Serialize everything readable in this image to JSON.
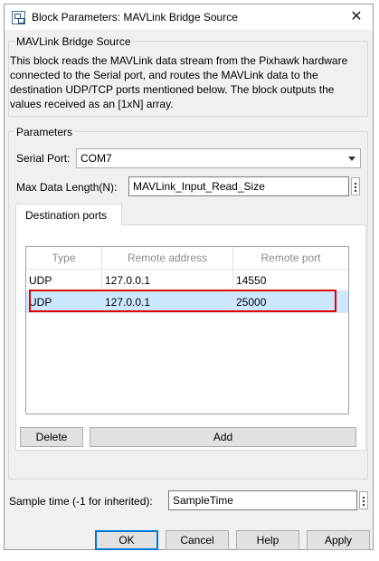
{
  "window": {
    "title": "Block Parameters: MAVLink Bridge Source",
    "close_glyph": "✕"
  },
  "block_group": {
    "legend": "MAVLink Bridge Source",
    "description": "This block reads the MAVLink data stream from the Pixhawk hardware connected to the Serial port, and routes the MAVLink data to the destination UDP/TCP ports mentioned below. The block outputs the values received as an [1xN] array."
  },
  "parameters": {
    "legend": "Parameters",
    "serial_port": {
      "label": "Serial Port:",
      "value": "COM7"
    },
    "max_data_length": {
      "label": "Max Data Length(N):",
      "value": "MAVLink_Input_Read_Size"
    }
  },
  "destination_ports": {
    "tab_label": "Destination ports",
    "columns": [
      "Type",
      "Remote address",
      "Remote port"
    ],
    "rows": [
      {
        "type": "UDP",
        "address": "127.0.0.1",
        "port": "14550"
      },
      {
        "type": "UDP",
        "address": "127.0.0.1",
        "port": "25000"
      }
    ],
    "delete_label": "Delete",
    "add_label": "Add"
  },
  "sample_time": {
    "label": "Sample time (-1 for inherited):",
    "value": "SampleTime"
  },
  "footer": {
    "ok": "OK",
    "cancel": "Cancel",
    "help": "Help",
    "apply": "Apply"
  },
  "colors": {
    "selection": "#cce8ff",
    "highlight": "#e00000",
    "default_button_border": "#0078d7"
  }
}
